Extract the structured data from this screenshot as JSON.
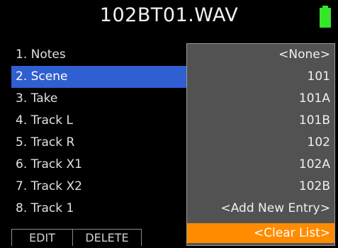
{
  "header": {
    "title": "102BT01.WAV",
    "battery_icon": "battery-full-icon",
    "battery_color": "#36e62b"
  },
  "menu": {
    "items": [
      {
        "label": "1. Notes"
      },
      {
        "label": "2. Scene"
      },
      {
        "label": "3. Take"
      },
      {
        "label": "4. Track L"
      },
      {
        "label": "5. Track R"
      },
      {
        "label": "6. Track X1"
      },
      {
        "label": "7. Track X2"
      },
      {
        "label": "8. Track 1"
      }
    ],
    "selected_index": 1,
    "selected_color": "#2f5fd0"
  },
  "softkeys": {
    "edit_label": "EDIT",
    "delete_label": "DELETE"
  },
  "dropdown": {
    "options": [
      {
        "label": "<None>"
      },
      {
        "label": "101"
      },
      {
        "label": "101A"
      },
      {
        "label": "101B"
      },
      {
        "label": "102"
      },
      {
        "label": "102A"
      },
      {
        "label": "102B"
      },
      {
        "label": "<Add New Entry>"
      },
      {
        "label": "<Clear List>"
      }
    ],
    "selected_index": 8,
    "selected_color": "#ff8c00",
    "background_color": "#525252"
  }
}
